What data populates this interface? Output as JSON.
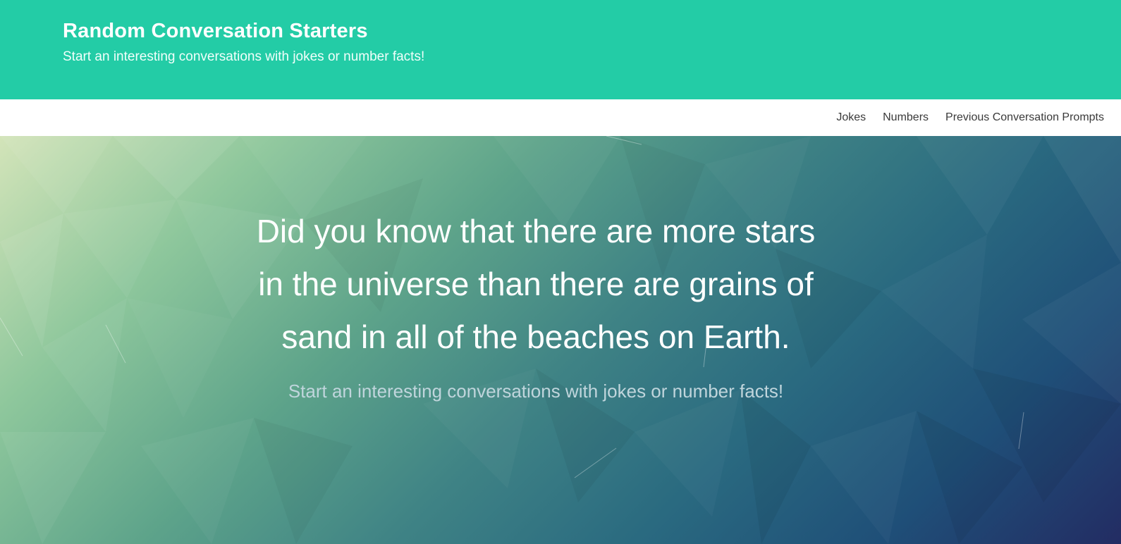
{
  "header": {
    "title": "Random Conversation Starters",
    "tagline": "Start an interesting conversations with jokes or number facts!"
  },
  "nav": {
    "items": [
      {
        "label": "Jokes"
      },
      {
        "label": "Numbers"
      },
      {
        "label": "Previous Conversation Prompts"
      }
    ]
  },
  "hero": {
    "headline": "Did you know that there are more stars in the universe than there are grains of sand in all of the beaches on Earth.",
    "subline": "Start an interesting conversations with jokes or number facts!"
  },
  "colors": {
    "header_bg": "#23cca6",
    "gradient_start": "#d3e4b9",
    "gradient_end": "#232c63"
  }
}
